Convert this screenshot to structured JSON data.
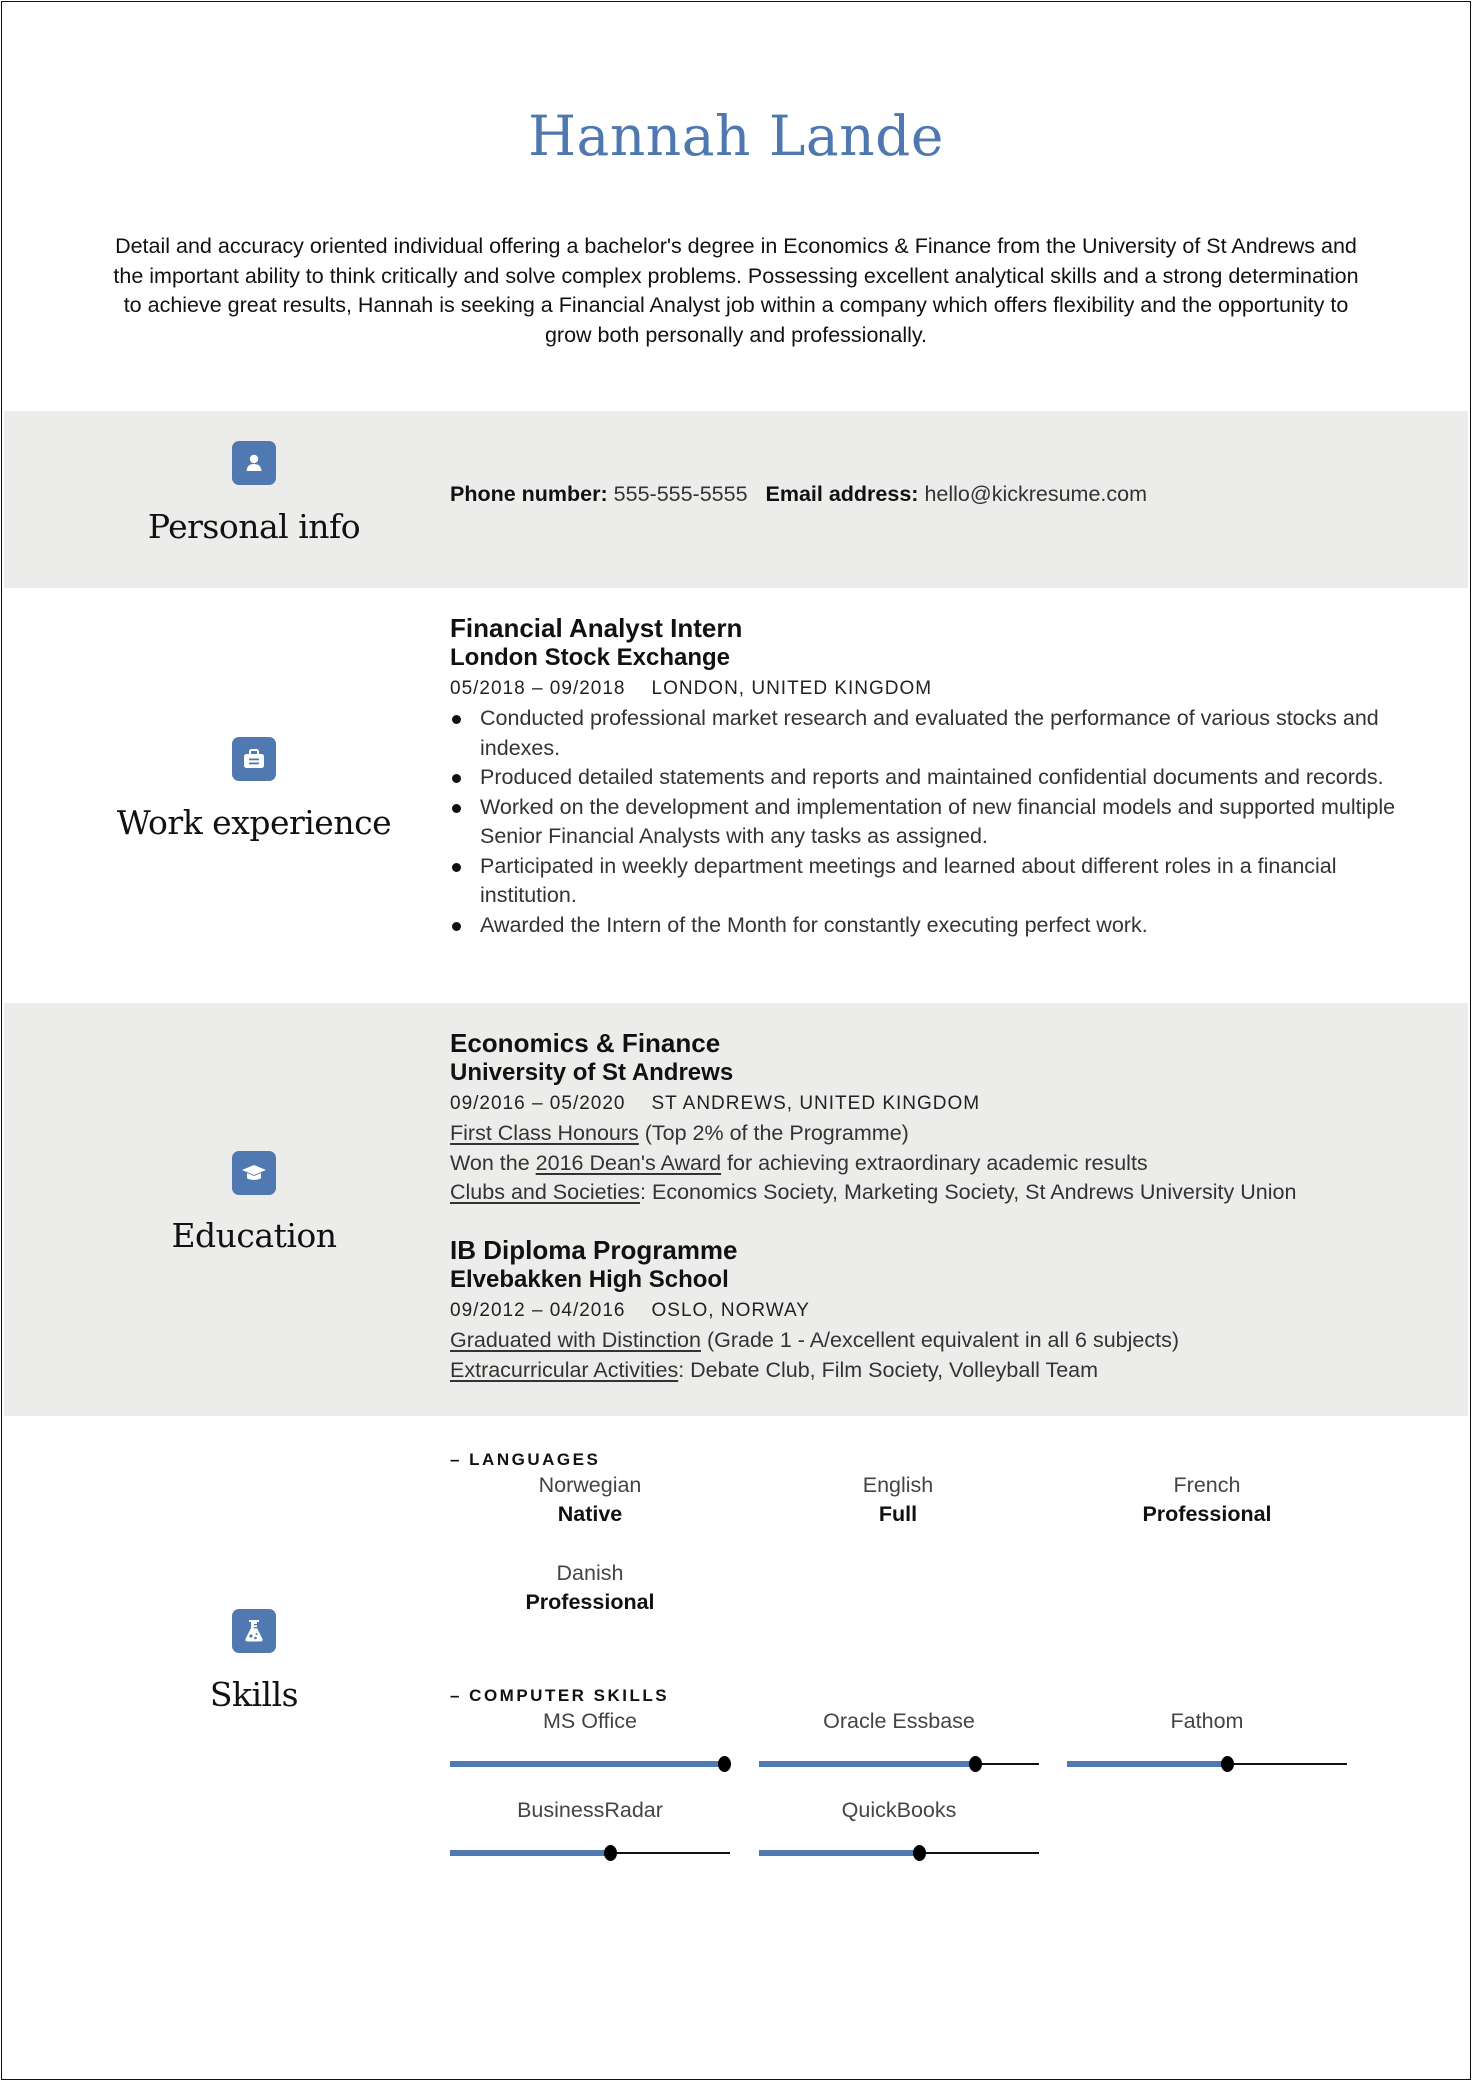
{
  "header": {
    "name": "Hannah Lande",
    "summary": "Detail and accuracy oriented individual offering a bachelor's degree in Economics & Finance from the University of St Andrews and the important ability to think critically and solve complex problems. Possessing excellent analytical skills and a strong determination to achieve great results, Hannah is seeking a Financial Analyst job within a company which offers flexibility and the opportunity to grow both personally and professionally."
  },
  "colors": {
    "accent": "#4f78b0",
    "band_gray": "#ececeb",
    "icon_bg": "#5179b1"
  },
  "personal_info": {
    "title": "Personal info",
    "icon": "user-icon",
    "phone_label": "Phone number:",
    "phone": "555-555-5555",
    "email_label": "Email address:",
    "email": "hello@kickresume.com"
  },
  "work": {
    "title": "Work experience",
    "icon": "briefcase-icon",
    "jobs": [
      {
        "title": "Financial Analyst Intern",
        "company": "London Stock Exchange",
        "dates": "05/2018 – 09/2018",
        "location": "LONDON, UNITED KINGDOM",
        "bullets": [
          "Conducted professional market research and evaluated the performance of various stocks and indexes.",
          "Produced detailed statements and reports and maintained confidential documents and records.",
          "Worked on the development and implementation of new financial models and supported multiple Senior Financial Analysts with any tasks as assigned.",
          "Participated in weekly department meetings and learned about different roles in a financial institution.",
          "Awarded the Intern of the Month for constantly executing perfect work."
        ]
      }
    ]
  },
  "education": {
    "title": "Education",
    "icon": "graduation-cap-icon",
    "entries": [
      {
        "degree": "Economics & Finance",
        "school": "University of St Andrews",
        "dates": "09/2016 – 05/2020",
        "location": "ST ANDREWS, UNITED KINGDOM",
        "line1_link": "First Class Honours",
        "line1_rest": " (Top 2% of the Programme)",
        "line2_pre": "Won the ",
        "line2_link": "2016 Dean's Award",
        "line2_rest": " for achieving extraordinary academic results",
        "line3_link": "Clubs and Societies",
        "line3_rest": ": Economics Society, Marketing Society, St Andrews University Union"
      },
      {
        "degree": "IB Diploma Programme",
        "school": "Elvebakken High School",
        "dates": "09/2012 – 04/2016",
        "location": "OSLO, NORWAY",
        "line1_link": "Graduated with Distinction",
        "line1_rest": " (Grade 1 - A/excellent equivalent in all 6 subjects)",
        "line2_link": "Extracurricular Activities",
        "line2_rest": ": Debate Club, Film Society, Volleyball Team"
      }
    ]
  },
  "skills": {
    "title": "Skills",
    "icon": "flask-icon",
    "languages_heading": "– LANGUAGES",
    "languages": [
      {
        "name": "Norwegian",
        "level": "Native"
      },
      {
        "name": "English",
        "level": "Full"
      },
      {
        "name": "French",
        "level": "Professional"
      },
      {
        "name": "Danish",
        "level": "Professional"
      }
    ],
    "computer_heading": "– COMPUTER SKILLS",
    "computer": [
      {
        "name": "MS Office",
        "level": 0.98
      },
      {
        "name": "Oracle Essbase",
        "level": 0.77
      },
      {
        "name": "Fathom",
        "level": 0.57
      },
      {
        "name": "BusinessRadar",
        "level": 0.57
      },
      {
        "name": "QuickBooks",
        "level": 0.57
      }
    ]
  }
}
